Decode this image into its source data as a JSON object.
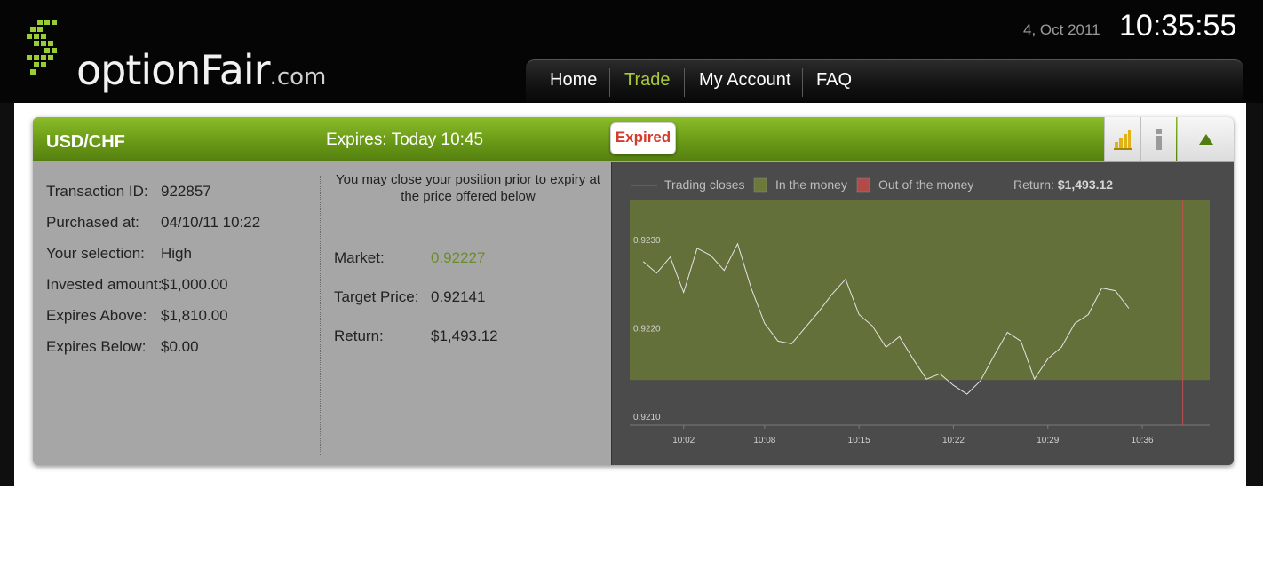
{
  "header": {
    "logo_text": "optionFair",
    "logo_suffix": ".com",
    "date": "4, Oct 2011",
    "clock": "10:35:55"
  },
  "nav": {
    "items": [
      {
        "label": "Home"
      },
      {
        "label": "Trade",
        "active": true
      },
      {
        "label": "My Account"
      },
      {
        "label": "FAQ"
      }
    ]
  },
  "option": {
    "pair": "USD/CHF",
    "expires_label": "Expires:  Today 10:45",
    "status_badge": "Expired",
    "details": [
      {
        "label": "Transaction ID:",
        "value": "922857"
      },
      {
        "label": "Purchased at:",
        "value": "04/10/11 10:22"
      },
      {
        "label": "Your selection:",
        "value": "High"
      },
      {
        "label": "Invested amount:",
        "value": "$1,000.00"
      },
      {
        "label": "Expires Above:",
        "value": "$1,810.00"
      },
      {
        "label": "Expires Below:",
        "value": "$0.00"
      }
    ],
    "close_note": "You may close your position prior to expiry at the price offered below",
    "market_label": "Market:",
    "market_value": "0.92227",
    "target_label": "Target Price:",
    "target_value": "0.92141",
    "return_label": "Return:",
    "return_value": "$1,493.12"
  },
  "icons": {
    "chart_button": "bar-chart-icon",
    "info_button": "info-icon",
    "collapse_button": "collapse-arrow-icon"
  },
  "colors": {
    "brand_green": "#7aa81f",
    "nav_active": "#a9c83a",
    "expired_red": "#d43b2b",
    "in_the_money": "#6b7a3a",
    "out_of_the_money": "#b34a4a",
    "trading_close_line": "#c05050"
  },
  "chart_data": {
    "type": "line",
    "legend": [
      {
        "label": "Trading closes"
      },
      {
        "label": "In the money"
      },
      {
        "label": "Out of the money"
      }
    ],
    "return_label": "Return:",
    "return_value": "$1,493.12",
    "y_ticks": [
      "0.9230",
      "0.9220",
      "0.9210"
    ],
    "y_tick_values": [
      0.923,
      0.922,
      0.921
    ],
    "x_ticks": [
      "10:02",
      "10:08",
      "10:15",
      "10:22",
      "10:29",
      "10:36"
    ],
    "ylim": [
      0.9209,
      0.92345
    ],
    "in_the_money_floor": 0.92141,
    "trading_closes_time": "10:39",
    "series": [
      {
        "x": [
          "09:59",
          "10:00",
          "10:01",
          "10:02",
          "10:03",
          "10:04",
          "10:05",
          "10:06",
          "10:07",
          "10:08",
          "10:09",
          "10:10",
          "10:11",
          "10:12",
          "10:13",
          "10:14",
          "10:15",
          "10:16",
          "10:17",
          "10:18",
          "10:19",
          "10:20",
          "10:21",
          "10:22",
          "10:23",
          "10:24",
          "10:25",
          "10:26",
          "10:27",
          "10:28",
          "10:29",
          "10:30",
          "10:31",
          "10:32",
          "10:33",
          "10:34",
          "10:35"
        ],
        "values": [
          0.92275,
          0.92262,
          0.9228,
          0.9224,
          0.9229,
          0.92282,
          0.92265,
          0.92295,
          0.92245,
          0.92205,
          0.92185,
          0.92182,
          0.922,
          0.92218,
          0.92238,
          0.92255,
          0.92215,
          0.92202,
          0.92178,
          0.9219,
          0.92165,
          0.92142,
          0.92148,
          0.92135,
          0.92125,
          0.9214,
          0.92168,
          0.92195,
          0.92185,
          0.92142,
          0.92165,
          0.92178,
          0.92205,
          0.92215,
          0.92245,
          0.92242,
          0.92222
        ]
      }
    ]
  }
}
